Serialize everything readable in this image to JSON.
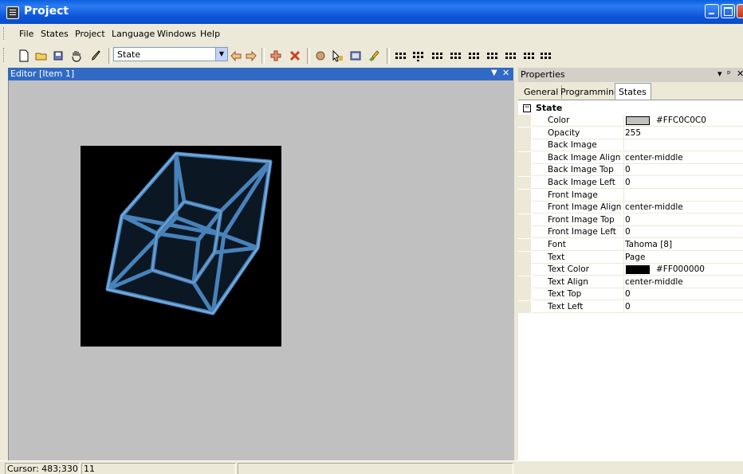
{
  "window": {
    "title": "Project"
  },
  "menu": [
    "File",
    "States",
    "Project",
    "Language",
    "Windows",
    "Help"
  ],
  "toolbar": {
    "state_select_value": "State"
  },
  "editor": {
    "title": "Editor [Item 1]",
    "image_alt": "tesseract"
  },
  "status": {
    "cursor": "Cursor: 483;330",
    "count": "11"
  },
  "properties": {
    "title": "Properties",
    "tabs": [
      "General",
      "Programming",
      "States"
    ],
    "active_tab": "States",
    "section": "State",
    "rows": [
      {
        "name": "Color",
        "value": "#FFC0C0C0",
        "swatch": "#c0c0c0"
      },
      {
        "name": "Opacity",
        "value": "255"
      },
      {
        "name": "Back Image",
        "value": ""
      },
      {
        "name": "Back Image Align",
        "value": "center-middle"
      },
      {
        "name": "Back Image Top",
        "value": "0"
      },
      {
        "name": "Back Image Left",
        "value": "0"
      },
      {
        "name": "Front Image",
        "value": ""
      },
      {
        "name": "Front Image Align",
        "value": "center-middle"
      },
      {
        "name": "Front Image Top",
        "value": "0"
      },
      {
        "name": "Front Image Left",
        "value": "0"
      },
      {
        "name": "Font",
        "value": "Tahoma [8]"
      },
      {
        "name": "Text",
        "value": "Page"
      },
      {
        "name": "Text Color",
        "value": "#FF000000",
        "swatch": "#000000"
      },
      {
        "name": "Text Align",
        "value": "center-middle"
      },
      {
        "name": "Text Top",
        "value": "0"
      },
      {
        "name": "Text Left",
        "value": "0"
      }
    ]
  }
}
